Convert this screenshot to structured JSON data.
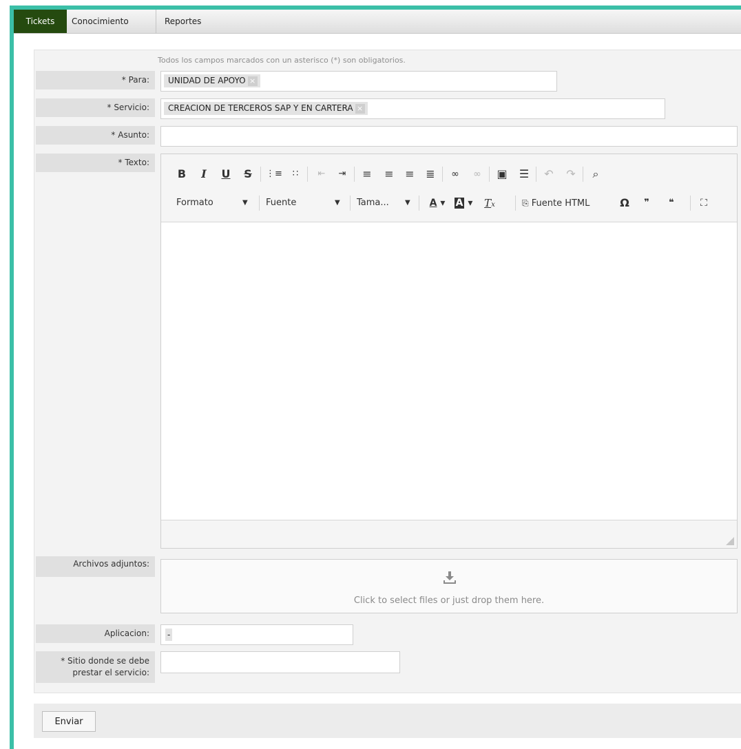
{
  "nav": {
    "tabs": [
      "Tickets",
      "Conocimiento",
      "Reportes"
    ],
    "active_tab": "Tickets"
  },
  "form": {
    "required_note": "Todos los campos marcados con un asterisco (*) son obligatorios.",
    "para": {
      "label": "* Para:",
      "tag": "UNIDAD DE APOYO"
    },
    "servicio": {
      "label": "* Servicio:",
      "tag": "CREACION DE TERCEROS SAP Y EN CARTERA"
    },
    "asunto": {
      "label": "* Asunto:",
      "value": ""
    },
    "texto": {
      "label": "* Texto:"
    },
    "adjuntos": {
      "label": "Archivos adjuntos:",
      "dropzone_text": "Click to select files or just drop them here."
    },
    "aplicacion": {
      "label": "Aplicacion:",
      "value": "-"
    },
    "sitio": {
      "label_line1": "* Sitio donde se debe",
      "label_line2": "prestar el servicio:",
      "value": ""
    }
  },
  "editor": {
    "formato_label": "Formato",
    "fuente_label": "Fuente",
    "tamano_label": "Tama...",
    "source_label": "Fuente HTML"
  },
  "footer": {
    "submit_label": "Enviar"
  },
  "colors": {
    "accent_frame": "#3bbfa7",
    "active_tab": "#254a0f"
  }
}
